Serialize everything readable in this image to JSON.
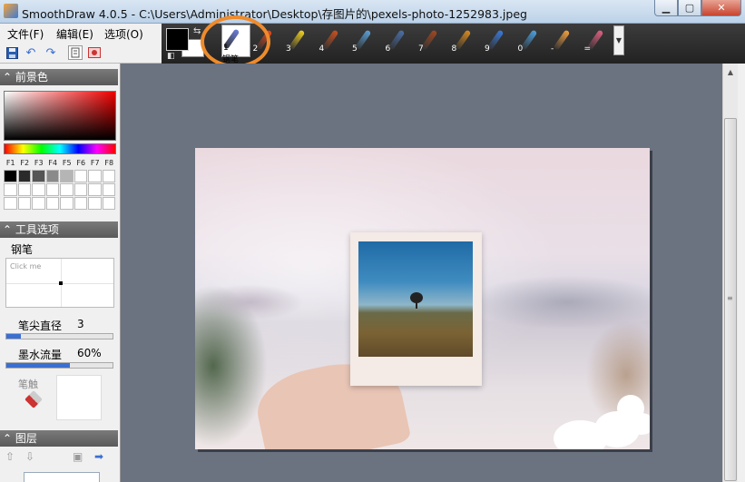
{
  "window": {
    "title": "SmoothDraw 4.0.5 - C:\\Users\\Administrator\\Desktop\\存图片的\\pexels-photo-1252983.jpeg",
    "min_glyph": "▁",
    "max_glyph": "▢",
    "close_glyph": "✕"
  },
  "menu": {
    "file": "文件(F)",
    "edit": "编辑(E)",
    "options": "选项(O)"
  },
  "quickbar": {
    "save_icon": "save-icon",
    "undo_icon": "undo-icon",
    "redo_icon": "redo-icon",
    "page_icon": "page-icon",
    "image_icon": "image-icon"
  },
  "toolbar": {
    "fg_color": "#000000",
    "bg_color": "#ffffff",
    "tools": [
      {
        "num": "1",
        "name": "pen",
        "color": "#6a7fd8"
      },
      {
        "num": "2",
        "name": "pencil",
        "color": "#e04a20"
      },
      {
        "num": "3",
        "name": "crayon",
        "color": "#f0d020"
      },
      {
        "num": "4",
        "name": "brush",
        "color": "#c8501e"
      },
      {
        "num": "5",
        "name": "airbrush",
        "color": "#5aa0d8"
      },
      {
        "num": "6",
        "name": "technical-pen",
        "color": "#4a6fa8"
      },
      {
        "num": "7",
        "name": "oil-brush",
        "color": "#a04820"
      },
      {
        "num": "8",
        "name": "flat-brush",
        "color": "#d88a20"
      },
      {
        "num": "9",
        "name": "sparkle",
        "color": "#3a7ad8"
      },
      {
        "num": "0",
        "name": "water-drop",
        "color": "#4aa0e0"
      },
      {
        "num": "-",
        "name": "smudge-finger",
        "color": "#f0a040"
      },
      {
        "num": "=",
        "name": "eraser",
        "color": "#e06080"
      }
    ],
    "selected_label": "钢笔",
    "more_glyph": "▼"
  },
  "panels": {
    "foreground": {
      "title": "前景色",
      "fkeys": [
        "F1",
        "F2",
        "F3",
        "F4",
        "F5",
        "F6",
        "F7",
        "F8"
      ],
      "swatches": [
        "#000000",
        "#2a2a2a",
        "#555555",
        "#8a8a8a",
        "#b5b5b5",
        "#ffffff",
        "#ffffff",
        "#ffffff"
      ]
    },
    "tool_options": {
      "title": "工具选项",
      "tool_name": "钢笔",
      "curve_hint": "Click me",
      "tip_diameter_label": "笔尖直径",
      "tip_diameter_value": "3",
      "tip_diameter_fraction": 0.14,
      "ink_flow_label": "墨水流量",
      "ink_flow_value": "60%",
      "ink_flow_fraction": 0.6,
      "pressure_label": "笔触"
    },
    "layers": {
      "title": "图层"
    }
  }
}
